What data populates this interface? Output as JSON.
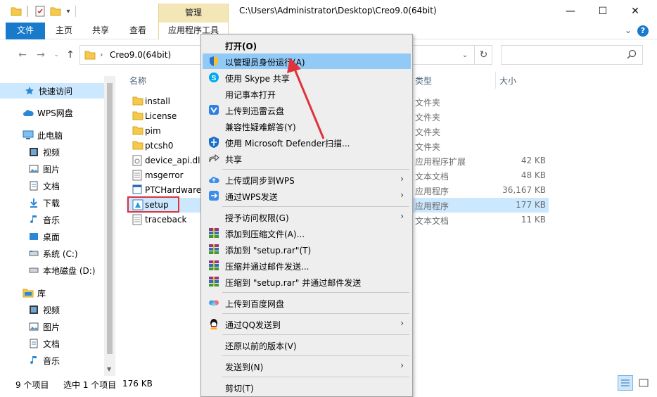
{
  "title_bar": {
    "context_tab": "管理",
    "window_title": "C:\\Users\\Administrator\\Desktop\\Creo9.0(64bit)",
    "minimize": "—",
    "maximize": "☐",
    "close": "✕"
  },
  "ribbon": {
    "tabs": [
      "文件",
      "主页",
      "共享",
      "查看",
      "应用程序工具"
    ],
    "help": "?"
  },
  "address_bar": {
    "breadcrumb": "Creo9.0(64bit)",
    "search_placeholder": ""
  },
  "sidebar": {
    "items": [
      {
        "label": "快速访问",
        "icon": "star-icon"
      },
      {
        "label": "WPS网盘",
        "icon": "cloud-icon"
      },
      {
        "label": "此电脑",
        "icon": "computer-icon"
      },
      {
        "label": "视频",
        "icon": "video-icon"
      },
      {
        "label": "图片",
        "icon": "picture-icon"
      },
      {
        "label": "文档",
        "icon": "document-icon"
      },
      {
        "label": "下载",
        "icon": "download-icon"
      },
      {
        "label": "音乐",
        "icon": "music-icon"
      },
      {
        "label": "桌面",
        "icon": "desktop-icon"
      },
      {
        "label": "系统 (C:)",
        "icon": "drive-icon"
      },
      {
        "label": "本地磁盘 (D:)",
        "icon": "drive-icon"
      },
      {
        "label": "库",
        "icon": "library-icon"
      },
      {
        "label": "视频",
        "icon": "video-icon"
      },
      {
        "label": "图片",
        "icon": "picture-icon"
      },
      {
        "label": "文档",
        "icon": "document-icon"
      },
      {
        "label": "音乐",
        "icon": "music-icon"
      }
    ]
  },
  "columns": {
    "name": "名称",
    "type": "类型",
    "size": "大小"
  },
  "files": [
    {
      "name": "install",
      "type": "文件夹",
      "size": "",
      "icon": "folder-icon"
    },
    {
      "name": "License",
      "type": "文件夹",
      "size": "",
      "icon": "folder-icon"
    },
    {
      "name": "pim",
      "type": "文件夹",
      "size": "",
      "icon": "folder-icon"
    },
    {
      "name": "ptcsh0",
      "type": "文件夹",
      "size": "",
      "icon": "folder-icon"
    },
    {
      "name": "device_api.dll",
      "type": "应用程序扩展",
      "size": "42 KB",
      "icon": "dll-icon"
    },
    {
      "name": "msgerror",
      "type": "文本文档",
      "size": "48 KB",
      "icon": "text-file-icon"
    },
    {
      "name": "PTCHardware",
      "type": "应用程序",
      "size": "36,167 KB",
      "icon": "app-icon"
    },
    {
      "name": "setup",
      "type": "应用程序",
      "size": "177 KB",
      "icon": "setup-icon"
    },
    {
      "name": "traceback",
      "type": "文本文档",
      "size": "11 KB",
      "icon": "text-file-icon"
    }
  ],
  "status_bar": {
    "item_count": "9 个项目",
    "selection": "选中 1 个项目",
    "selection_size": "176 KB"
  },
  "context_menu": {
    "items": [
      {
        "label": "打开(O)",
        "icon": "",
        "bold": true
      },
      {
        "label": "以管理员身份运行(A)",
        "icon": "shield-icon"
      },
      {
        "label": "使用 Skype 共享",
        "icon": "skype-icon"
      },
      {
        "label": "用记事本打开",
        "icon": ""
      },
      {
        "label": "上传到迅雷云盘",
        "icon": "xunlei-icon"
      },
      {
        "label": "兼容性疑难解答(Y)",
        "icon": ""
      },
      {
        "label": "使用 Microsoft Defender扫描...",
        "icon": "defender-icon"
      },
      {
        "label": "共享",
        "icon": "share-icon"
      },
      {
        "label": "上传或同步到WPS",
        "icon": "wps-cloud-icon",
        "submenu": true
      },
      {
        "label": "通过WPS发送",
        "icon": "wps-send-icon",
        "submenu": true
      },
      {
        "label": "授予访问权限(G)",
        "icon": "",
        "submenu": true
      },
      {
        "label": "添加到压缩文件(A)...",
        "icon": "winrar-icon"
      },
      {
        "label": "添加到 \"setup.rar\"(T)",
        "icon": "winrar-icon"
      },
      {
        "label": "压缩并通过邮件发送...",
        "icon": "winrar-icon"
      },
      {
        "label": "压缩到 \"setup.rar\" 并通过邮件发送",
        "icon": "winrar-icon"
      },
      {
        "label": "上传到百度网盘",
        "icon": "baidu-icon"
      },
      {
        "label": "通过QQ发送到",
        "icon": "qq-icon",
        "submenu": true
      },
      {
        "label": "还原以前的版本(V)",
        "icon": ""
      },
      {
        "label": "发送到(N)",
        "icon": "",
        "submenu": true
      },
      {
        "label": "剪切(T)",
        "icon": ""
      }
    ],
    "submenu_arrow": "›"
  },
  "colors": {
    "accent": "#1979ca",
    "selection": "#cce8ff",
    "menu_hover": "#91c9f7",
    "annotation": "#e0323a"
  }
}
